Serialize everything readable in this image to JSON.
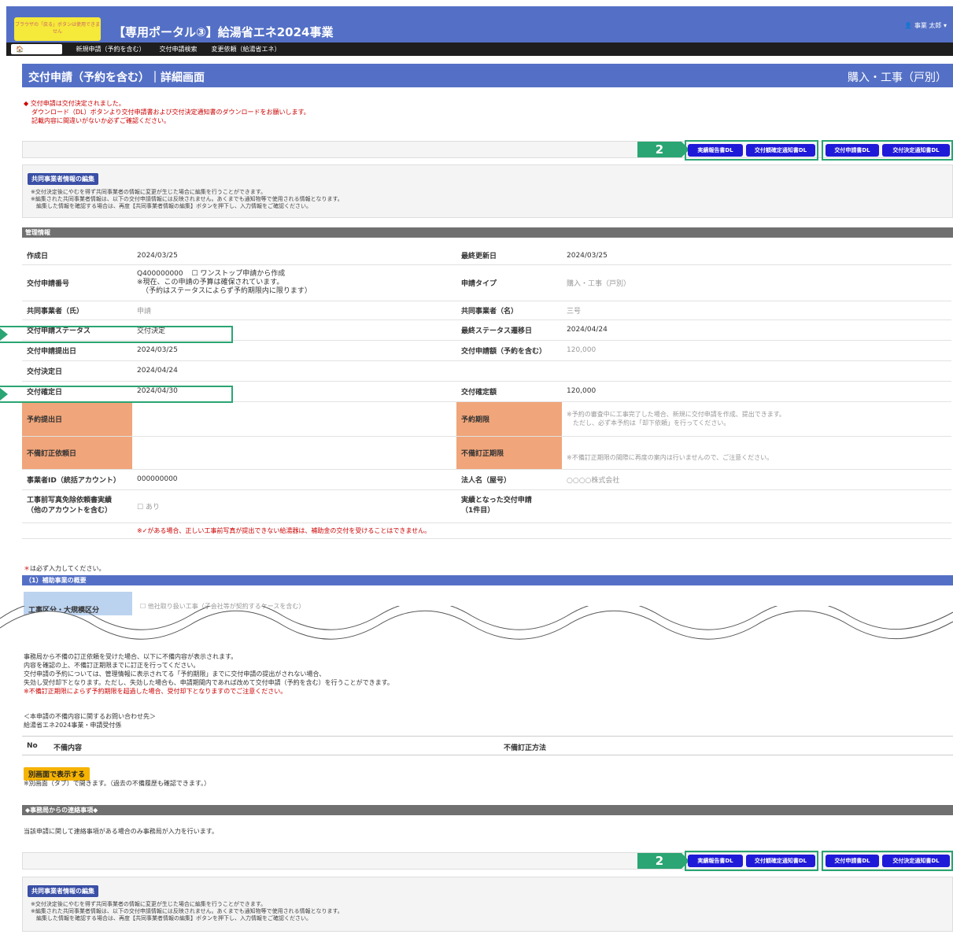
{
  "header": {
    "warning": "ブラウザの「戻る」ボタンは使用できません",
    "title": "【専用ポータル③】給湯省エネ2024事業",
    "user": "事業 太郎"
  },
  "nav": {
    "top": "TOPに戻る",
    "items": [
      "新規申請（予約を含む）",
      "交付申請検索",
      "変更依頼（給湯省エネ）"
    ]
  },
  "page": {
    "title": "交付申請（予約を含む）｜詳細画面",
    "type": "購入・工事（戸別）"
  },
  "notice": [
    "◆ 交付申請は交付決定されました。",
    "ダウンロード（DL）ボタンより交付申請書および交付決定通知書のダウンロードをお願いします。",
    "記載内容に間違いがないか必ずご確認ください。"
  ],
  "badge": "2",
  "buttons": {
    "jisseki": "実績報告書DL",
    "kakutei": "交付額確定通知書DL",
    "shinsei": "交付申請書DL",
    "kettei": "交付決定通知書DL"
  },
  "edit": {
    "button": "共同事業者情報の編集",
    "notes": [
      "※交付決定後にやむを得ず共同事業者の情報に変更が生じた場合に編集を行うことができます。",
      "※編集された共同事業者情報は、以下の交付申請情報には反映されません。あくまでも通知物等で使用される情報となります。",
      "　編集した情報を確認する場合は、再度【共同事業者情報の編集】ボタンを押下し、入力情報をご確認ください。"
    ]
  },
  "mgmt": {
    "heading": "管理情報",
    "created_k": "作成日",
    "created_v": "2024/03/25",
    "updated_k": "最終更新日",
    "updated_v": "2024/03/25",
    "num_k": "交付申請番号",
    "num_v": "Q400000000",
    "onestop": "ワンストップ申請から作成",
    "num_note1": "※現在、この申請の予算は確保されています。",
    "num_note2": "（予約はステータスによらず予約期限内に限ります）",
    "type_k": "申請タイプ",
    "type_v": "購入・工事（戸別）",
    "sei_k": "共同事業者（氏）",
    "sei_v": "申請",
    "mei_k": "共同事業者（名）",
    "mei_v": "三号",
    "status_k": "交付申請ステータス",
    "status_v": "交付決定",
    "trans_k": "最終ステータス遷移日",
    "trans_v": "2024/04/24",
    "submit_k": "交付申請提出日",
    "submit_v": "2024/03/25",
    "amount_k": "交付申請額（予約を含む）",
    "amount_v": "120,000",
    "decide_k": "交付決定日",
    "decide_v": "2024/04/24",
    "confirm_k": "交付確定日",
    "confirm_v": "2024/04/30",
    "confamt_k": "交付確定額",
    "confamt_v": "120,000",
    "resv_k": "予約提出日",
    "resvlim_k": "予約期限",
    "resvlim_v1": "※予約の審査中に工事完了した場合、新規に交付申請を作成、提出できます。",
    "resvlim_v2": "　ただし、必ず本予約は「却下依頼」を行ってください。",
    "fix_k": "不備訂正依頼日",
    "fixlim_k": "不備訂正期限",
    "fixlim_v": "※不備訂正期限の間際に再度の案内は行いませんので、ご注意ください。",
    "id_k": "事業者ID（統括アカウント）",
    "id_v": "000000000",
    "corp_k": "法人名（屋号）",
    "corp_v": "○○○○株式会社",
    "photo_k1": "工事前写真免除依頼書実績",
    "photo_k2": "（他のアカウントを含む）",
    "photo_v": "あり",
    "result_k1": "実績となった交付申請",
    "result_k2": "（1件目）",
    "photo_note": "※✓がある場合、正しい工事前写真が提出できない給湯器は、補助金の交付を受けることはできません。"
  },
  "required_note": "は必ず入力してください。",
  "sec1": {
    "title": "（1）補助事業の概要",
    "row_label": "工事区分・大規模区分",
    "option": "他社取り扱い工事（子会社等が契約するケースを含む）"
  },
  "defect": {
    "lines": [
      "事務局から不備の訂正依頼を受けた場合、以下に不備内容が表示されます。",
      "内容を確認の上、不備訂正期限までに訂正を行ってください。",
      "交付申請の予約については、管理情報に表示されてる「予約期限」までに交付申請の提出がされない場合、",
      "失効し受付却下となります。ただし、失効した場合も、申請期間内であれば改めて交付申請（予約を含む）を行うことができます。"
    ],
    "red_line": "※不備訂正期限によらず予約期限を超過した場合、受付却下となりますのでご注意ください。",
    "contact1": "＜本申請の不備内容に関するお問い合わせ先＞",
    "contact2": "給湯省エネ2024事業・申請受付係",
    "col_no": "No",
    "col_content": "不備内容",
    "col_method": "不備訂正方法",
    "sep_button": "別画面で表示する",
    "sep_note": "※別画面（タブ）で開きます。（過去の不備履歴も確認できます。）"
  },
  "office": {
    "title": "◆事務局からの連絡事項◆",
    "note": "当該申請に関して連絡事項がある場合のみ事務局が入力を行います。"
  },
  "colors": {
    "brand": "#5470c6",
    "highlight": "#2aa573",
    "dl_button": "#1f1ad8",
    "orange": "#f0a57a"
  }
}
